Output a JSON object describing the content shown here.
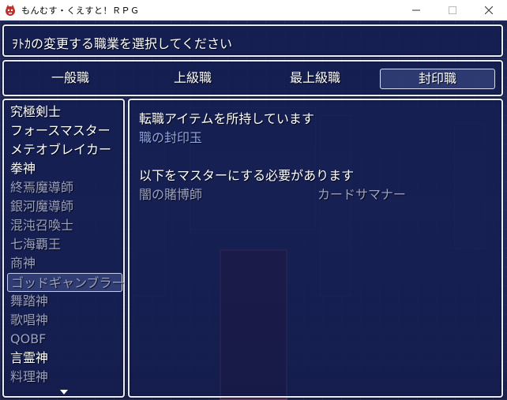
{
  "window": {
    "title": "もんむす・くえすと！ＲＰＧ",
    "icon": "red-monster-app-icon",
    "controls": [
      "minimize",
      "maximize",
      "close"
    ]
  },
  "help": {
    "text": "ｦﾄｶの変更する職業を選択してください"
  },
  "categories": {
    "tabs": [
      {
        "label": "一般職"
      },
      {
        "label": "上級職"
      },
      {
        "label": "最上級職"
      },
      {
        "label": "封印職"
      }
    ],
    "selected": "封印職"
  },
  "job_list": {
    "items": [
      {
        "label": "究極剣士",
        "state": "available"
      },
      {
        "label": "フォースマスター",
        "state": "available"
      },
      {
        "label": "メテオブレイカー",
        "state": "available"
      },
      {
        "label": "拳神",
        "state": "available"
      },
      {
        "label": "終焉魔導師",
        "state": "disabled"
      },
      {
        "label": "銀河魔導師",
        "state": "disabled"
      },
      {
        "label": "混沌召喚士",
        "state": "disabled"
      },
      {
        "label": "七海覇王",
        "state": "disabled"
      },
      {
        "label": "商神",
        "state": "disabled"
      },
      {
        "label": "ゴッドギャンブラー",
        "state": "disabled"
      },
      {
        "label": "舞踏神",
        "state": "disabled"
      },
      {
        "label": "歌唱神",
        "state": "disabled"
      },
      {
        "label": "QOBF",
        "state": "disabled"
      },
      {
        "label": "言霊神",
        "state": "available"
      },
      {
        "label": "料理神",
        "state": "disabled"
      }
    ],
    "cursor": "ゴッドギャンブラー",
    "more_indicator": "down-arrow-icon"
  },
  "detail": {
    "item_heading": "転職アイテムを所持しています",
    "item_name": "職の封印玉",
    "req_heading": "以下をマスターにする必要があります",
    "requirements": [
      "闇の賭博師",
      "カードサマナー"
    ]
  },
  "colors": {
    "window_bg": "#121c4e",
    "border": "#e8ecf6",
    "text": "#ffffff",
    "dim_text": "#9aa0c0",
    "system_text": "#8fa4e0"
  }
}
